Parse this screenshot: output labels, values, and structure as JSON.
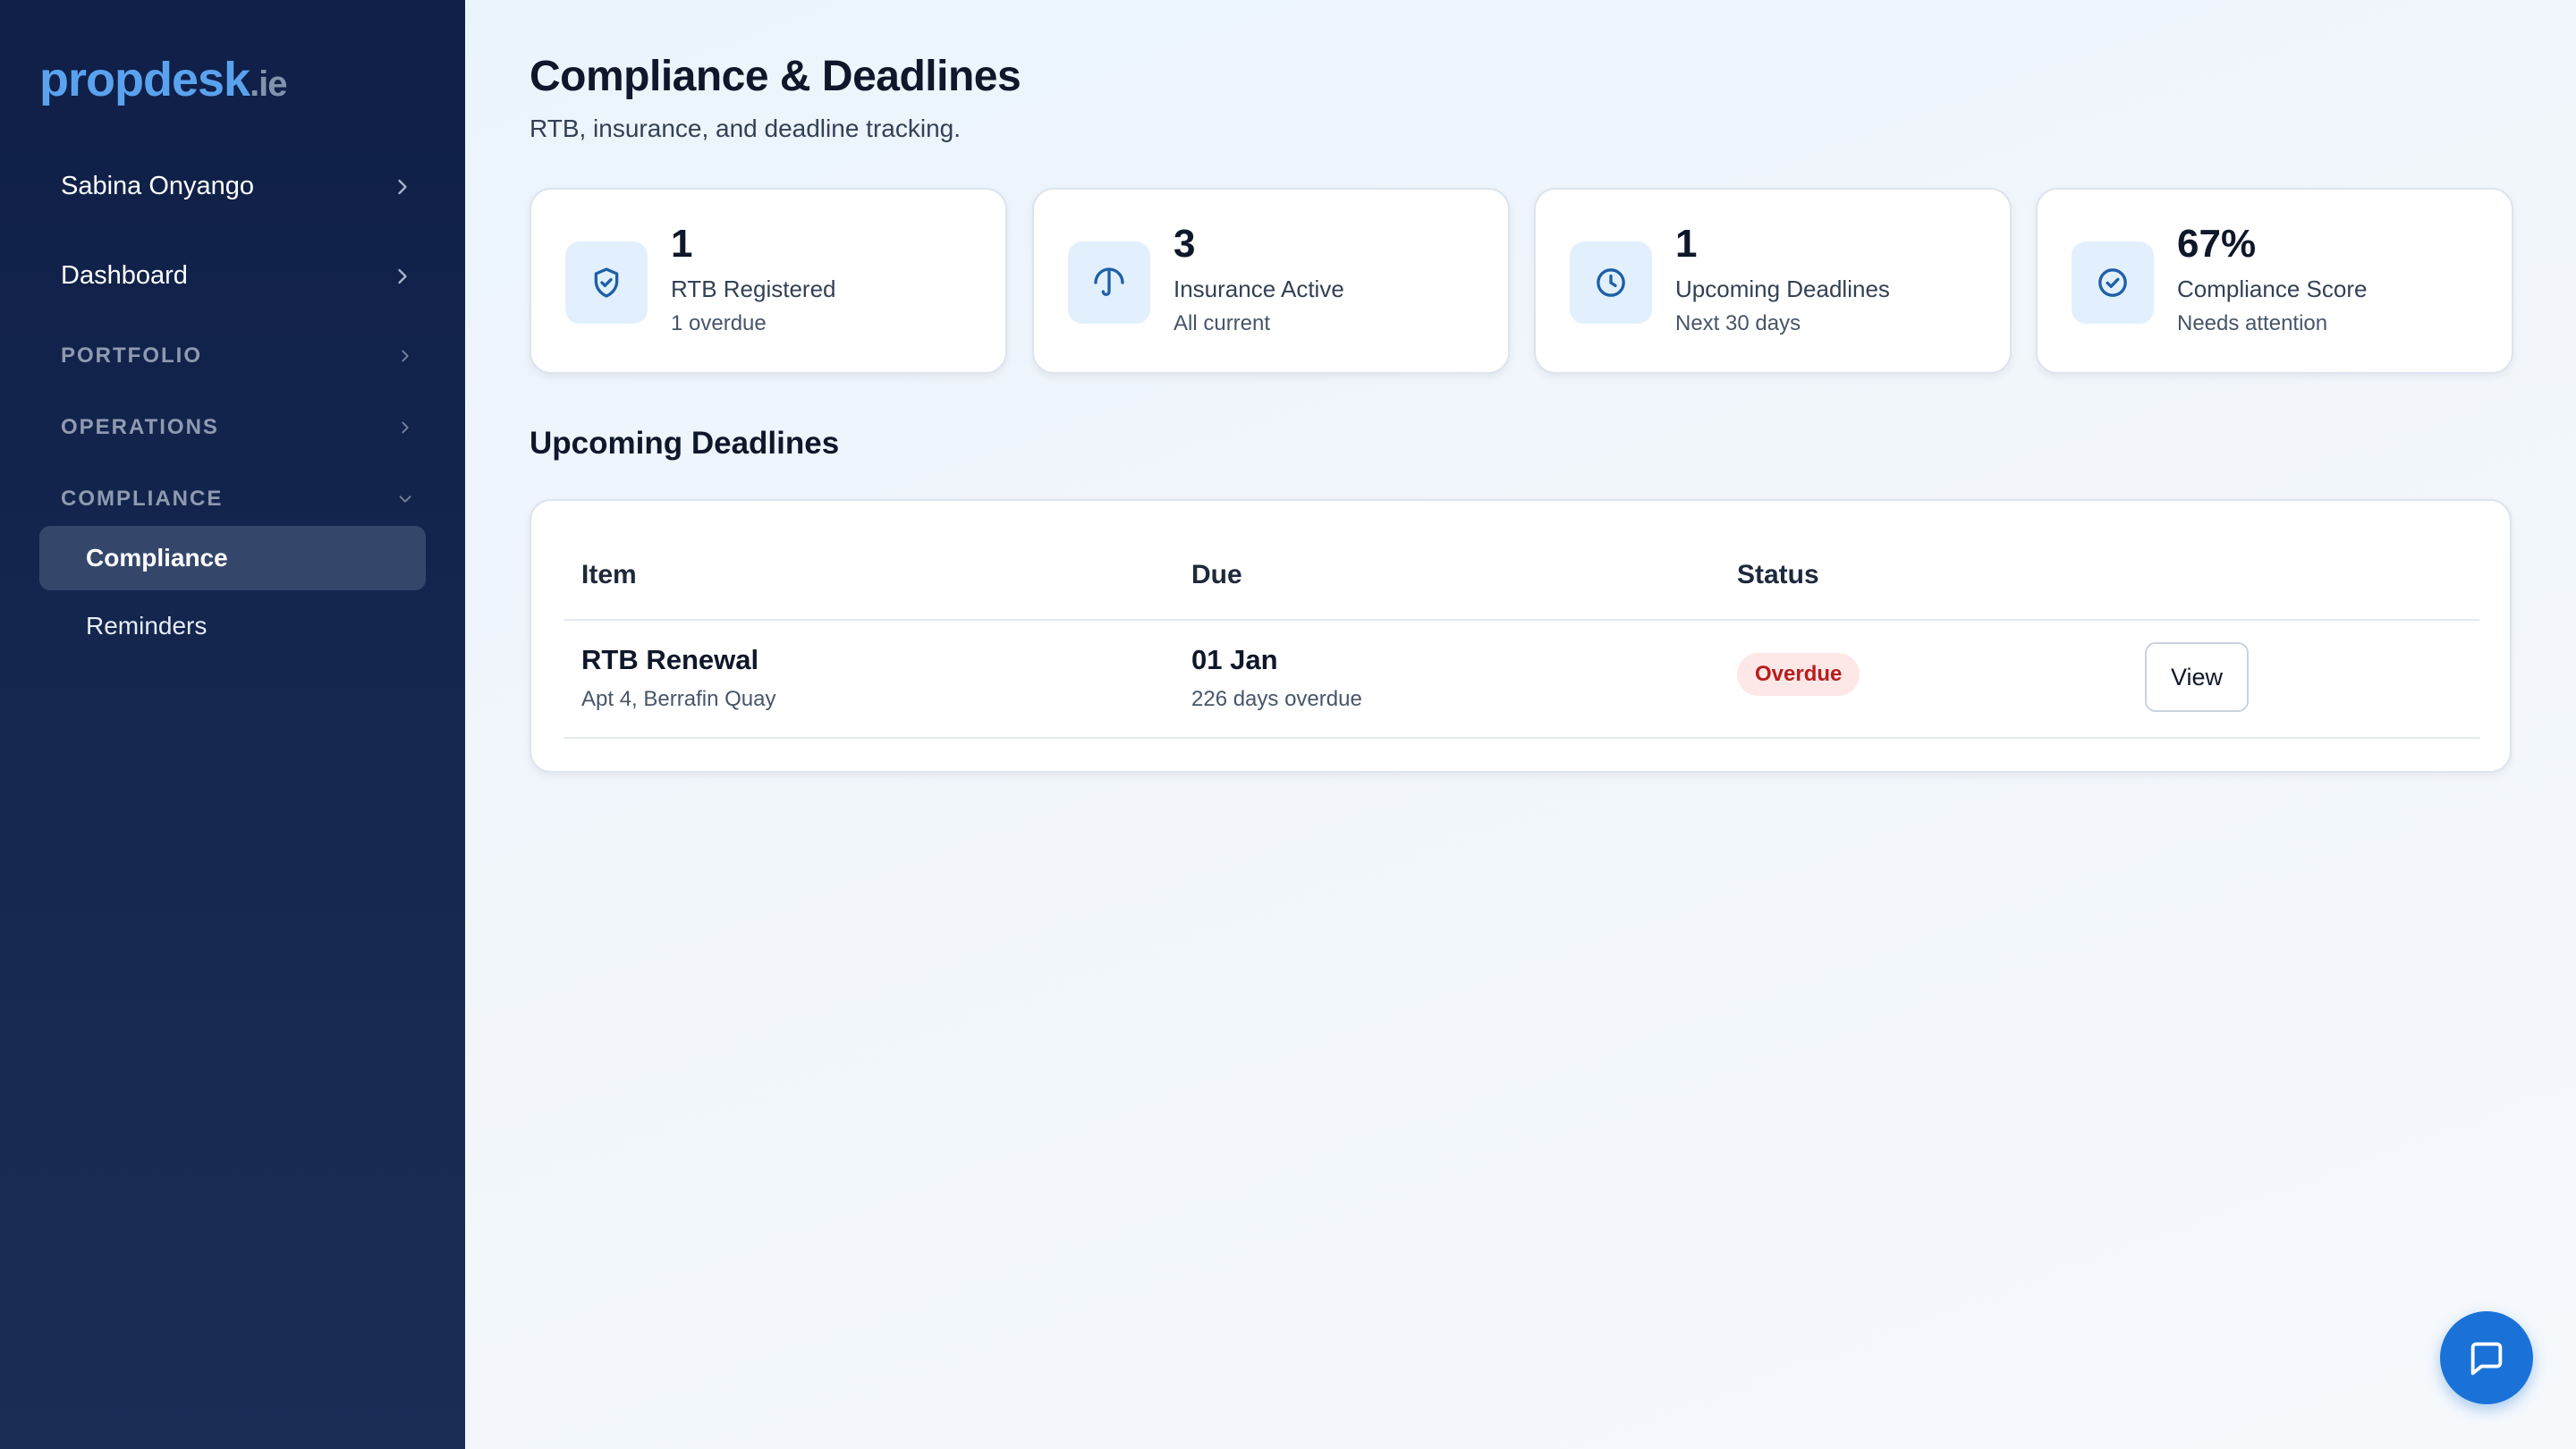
{
  "brand": {
    "name": "propdesk",
    "tld": ".ie"
  },
  "sidebar": {
    "user": "Sabina Onyango",
    "dashboard": "Dashboard",
    "sections": [
      {
        "label": "PORTFOLIO",
        "expanded": false
      },
      {
        "label": "OPERATIONS",
        "expanded": false
      },
      {
        "label": "COMPLIANCE",
        "expanded": true
      }
    ],
    "compliance_items": [
      {
        "label": "Compliance",
        "active": true
      },
      {
        "label": "Reminders",
        "active": false
      }
    ]
  },
  "page": {
    "title": "Compliance & Deadlines",
    "subtitle": "RTB, insurance, and deadline tracking."
  },
  "stats": [
    {
      "icon": "shield-check-icon",
      "value": "1",
      "label": "RTB Registered",
      "sub": "1 overdue"
    },
    {
      "icon": "umbrella-icon",
      "value": "3",
      "label": "Insurance Active",
      "sub": "All current"
    },
    {
      "icon": "clock-icon",
      "value": "1",
      "label": "Upcoming Deadlines",
      "sub": "Next 30 days"
    },
    {
      "icon": "check-circle-icon",
      "value": "67%",
      "label": "Compliance Score",
      "sub": "Needs attention"
    }
  ],
  "deadlines": {
    "title": "Upcoming Deadlines",
    "columns": {
      "item": "Item",
      "due": "Due",
      "status": "Status"
    },
    "rows": [
      {
        "item": "RTB Renewal",
        "property": "Apt 4, Berrafin Quay",
        "due": "01 Jan",
        "due_note": "226 days overdue",
        "status": "Overdue",
        "action": "View"
      }
    ]
  },
  "colors": {
    "sidebar_bg": "#0f1f47",
    "accent": "#1a72d9",
    "brand": "#5aa2ee",
    "overdue_text": "#b91c1c",
    "overdue_bg": "#fde7e7",
    "icon_tile": "#e2f0fd"
  },
  "fab": {
    "icon": "chat-bubble-icon"
  }
}
